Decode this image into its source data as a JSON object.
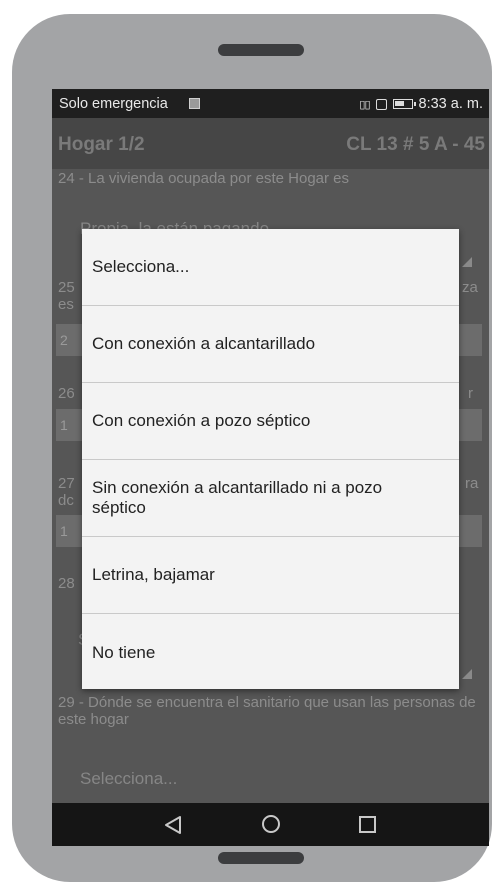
{
  "status_bar": {
    "carrier": "Solo emergencia",
    "time": "8:33 a. m.",
    "vibrate_glyph": "¦0¦"
  },
  "header": {
    "title": "Hogar 1/2",
    "address": "CL 13 # 5 A - 45"
  },
  "form": {
    "q24": "24 - La vivienda ocupada por este Hogar es",
    "q24_answer": "Propia, la están pagando",
    "q25_start": "25",
    "q25_end": "za",
    "q25_line2": "es",
    "f25": "2",
    "q26_start": "26",
    "q26_end": "r",
    "f26": "1",
    "q27_start": "27",
    "q27_end": "ra",
    "q27_line2": "dc",
    "f27": "1",
    "q28_start": "28",
    "q28_answer_start": "S",
    "q29": "29 - Dónde se encuentra el sanitario que usan las personas de este hogar",
    "q29_answer": "Selecciona..."
  },
  "dialog": {
    "options": [
      "Selecciona...",
      "Con conexión a alcantarillado",
      "Con conexión a pozo séptico",
      "Sin conexión a alcantarillado ni a pozo séptico",
      "Letrina, bajamar",
      "No tiene"
    ]
  },
  "nav": {
    "back_icon": "triangle-back",
    "home_icon": "circle-home",
    "recent_icon": "square-recent"
  }
}
